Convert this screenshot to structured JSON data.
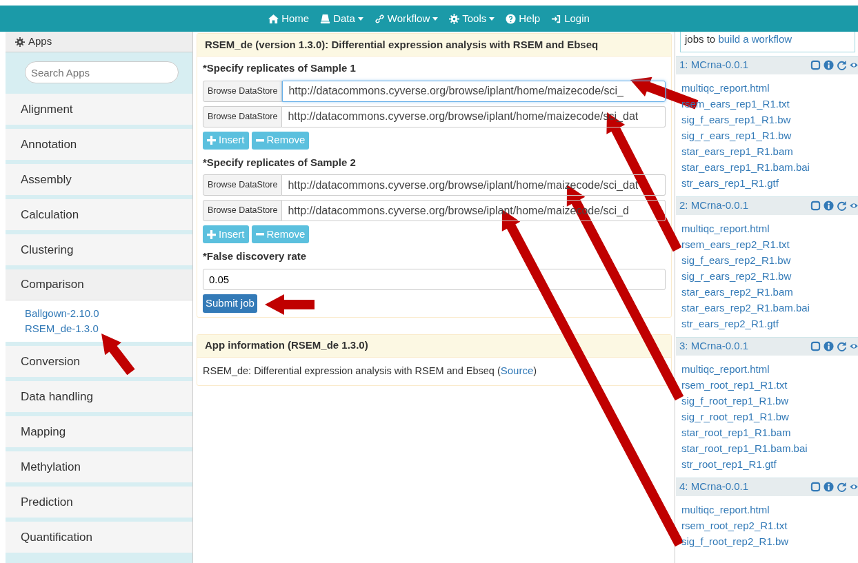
{
  "navbar": {
    "items": [
      {
        "label": "Home",
        "dropdown": false
      },
      {
        "label": "Data",
        "dropdown": true
      },
      {
        "label": "Workflow",
        "dropdown": true
      },
      {
        "label": "Tools",
        "dropdown": true
      },
      {
        "label": "Help",
        "dropdown": false
      },
      {
        "label": "Login",
        "dropdown": false
      }
    ]
  },
  "sidebar": {
    "title": "Apps",
    "search": {
      "placeholder": "Search Apps"
    },
    "categories": [
      {
        "label": "Alignment",
        "expanded": false
      },
      {
        "label": "Annotation",
        "expanded": false
      },
      {
        "label": "Assembly",
        "expanded": false
      },
      {
        "label": "Calculation",
        "expanded": false
      },
      {
        "label": "Clustering",
        "expanded": false
      },
      {
        "label": "Comparison",
        "expanded": true,
        "apps": [
          "Ballgown-2.10.0",
          "RSEM_de-1.3.0"
        ]
      },
      {
        "label": "Conversion",
        "expanded": false
      },
      {
        "label": "Data handling",
        "expanded": false
      },
      {
        "label": "Mapping",
        "expanded": false
      },
      {
        "label": "Methylation",
        "expanded": false
      },
      {
        "label": "Prediction",
        "expanded": false
      },
      {
        "label": "Quantification",
        "expanded": false
      }
    ]
  },
  "form": {
    "title": "RSEM_de (version 1.3.0): Differential expression analysis with RSEM and Ebseq",
    "sections": [
      {
        "kind": "replicates",
        "label": "*Specify replicates of Sample 1",
        "fields": [
          {
            "button": "Browse DataStore",
            "value": "http://datacommons.cyverse.org/browse/iplant/home/maizecode/sci_",
            "focused": true
          },
          {
            "button": "Browse DataStore",
            "value": "http://datacommons.cyverse.org/browse/iplant/home/maizecode/sci_dat",
            "focused": false
          }
        ],
        "buttons": [
          {
            "kind": "insert",
            "label": "Insert"
          },
          {
            "kind": "remove",
            "label": "Remove"
          }
        ]
      },
      {
        "kind": "replicates",
        "label": "*Specify replicates of Sample 2",
        "fields": [
          {
            "button": "Browse DataStore",
            "value": "http://datacommons.cyverse.org/browse/iplant/home/maizecode/sci_dat",
            "focused": false
          },
          {
            "button": "Browse DataStore",
            "value": "http://datacommons.cyverse.org/browse/iplant/home/maizecode/sci_d",
            "focused": false
          }
        ],
        "buttons": [
          {
            "kind": "insert",
            "label": "Insert"
          },
          {
            "kind": "remove",
            "label": "Remove"
          }
        ]
      },
      {
        "kind": "text",
        "label": "*False discovery rate",
        "value": "0.05"
      }
    ],
    "submit": "Submit job"
  },
  "info": {
    "title": "App information (RSEM_de 1.3.0)",
    "text_before": "RSEM_de: Differential expression analysis with RSEM and Ebseq (",
    "link": "Source",
    "text_after": ")"
  },
  "jobs_panel": {
    "hint_text": "jobs to",
    "hint_link": "build a workflow",
    "jobs": [
      {
        "title": "1: MCrna-0.0.1",
        "files": [
          "multiqc_report.html",
          "rsem_ears_rep1_R1.txt",
          "sig_f_ears_rep1_R1.bw",
          "sig_r_ears_rep1_R1.bw",
          "star_ears_rep1_R1.bam",
          "star_ears_rep1_R1.bam.bai",
          "str_ears_rep1_R1.gtf"
        ]
      },
      {
        "title": "2: MCrna-0.0.1",
        "files": [
          "multiqc_report.html",
          "rsem_ears_rep2_R1.txt",
          "sig_f_ears_rep2_R1.bw",
          "sig_r_ears_rep2_R1.bw",
          "star_ears_rep2_R1.bam",
          "star_ears_rep2_R1.bam.bai",
          "str_ears_rep2_R1.gtf"
        ]
      },
      {
        "title": "3: MCrna-0.0.1",
        "files": [
          "multiqc_report.html",
          "rsem_root_rep1_R1.txt",
          "sig_f_root_rep1_R1.bw",
          "sig_r_root_rep1_R1.bw",
          "star_root_rep1_R1.bam",
          "star_root_rep1_R1.bam.bai",
          "str_root_rep1_R1.gtf"
        ]
      },
      {
        "title": "4: MCrna-0.0.1",
        "files": [
          "multiqc_report.html",
          "rsem_root_rep2_R1.txt",
          "sig_f_root_rep2_R1.bw"
        ]
      }
    ]
  }
}
